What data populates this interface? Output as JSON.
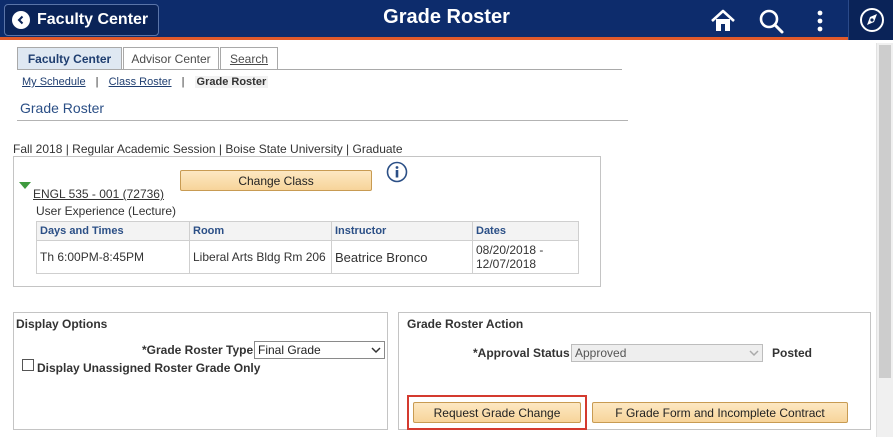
{
  "header": {
    "back_label": "Faculty Center",
    "title": "Grade Roster",
    "icons": [
      "home-icon",
      "search-icon",
      "more-vertical-icon",
      "navigator-icon"
    ],
    "colors": {
      "bar": "#0d2c6c",
      "accent": "#e05a2b"
    }
  },
  "tabs": [
    {
      "label": "Faculty Center",
      "active": true
    },
    {
      "label": "Advisor Center",
      "active": false
    },
    {
      "label": "Search",
      "active": false
    }
  ],
  "breadcrumb": {
    "items": [
      "My Schedule",
      "Class Roster"
    ],
    "separator": "|",
    "current": "Grade Roster"
  },
  "page": {
    "section_title": "Grade Roster",
    "term_line": "Fall 2018 | Regular Academic Session | Boise State University | Graduate"
  },
  "class": {
    "link": "ENGL 535 - 001 (72736)",
    "description": "User Experience (Lecture)",
    "change_button": "Change Class",
    "table": {
      "headers": [
        "Days and Times",
        "Room",
        "Instructor",
        "Dates"
      ],
      "row": {
        "days_times": "Th 6:00PM-8:45PM",
        "room": "Liberal Arts Bldg Rm 206",
        "instructor": "Beatrice Bronco",
        "dates": "08/20/2018 - 12/07/2018"
      }
    }
  },
  "display_options": {
    "title": "Display Options",
    "roster_type_label": "*Grade Roster Type",
    "roster_type_value": "Final Grade",
    "unassigned_label": "Display Unassigned Roster Grade Only",
    "unassigned_checked": false
  },
  "roster_action": {
    "title": "Grade Roster Action",
    "approval_label": "*Approval Status",
    "approval_value": "Approved",
    "posted_label": "Posted",
    "request_button": "Request Grade Change",
    "f_grade_button": "F Grade Form and Incomplete Contract"
  }
}
